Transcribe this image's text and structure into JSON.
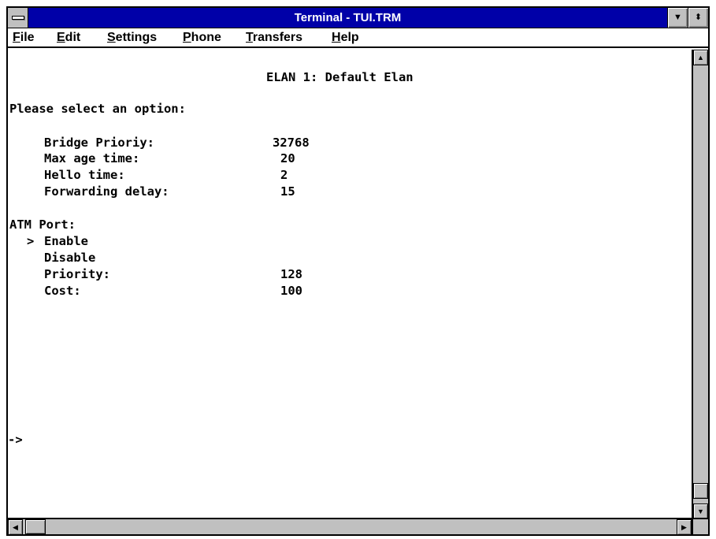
{
  "window": {
    "title": "Terminal - TUI.TRM",
    "minimize_glyph": "▼",
    "maximize_glyph": "⬍"
  },
  "menu": [
    {
      "underline": "F",
      "rest": "ile"
    },
    {
      "underline": "E",
      "rest": "dit"
    },
    {
      "underline": "S",
      "rest": "ettings"
    },
    {
      "underline": "P",
      "rest": "hone"
    },
    {
      "underline": "T",
      "rest": "ransfers"
    },
    {
      "underline": "H",
      "rest": "elp"
    }
  ],
  "terminal": {
    "header": "ELAN 1: Default Elan",
    "prompt_text": "Please select an option:",
    "settings": [
      {
        "label": "Bridge Prioriy:",
        "value": "32768"
      },
      {
        "label": "Max age time:",
        "value": "20"
      },
      {
        "label": "Hello time:",
        "value": "2"
      },
      {
        "label": "Forwarding delay:",
        "value": "15"
      }
    ],
    "atm_port": {
      "heading": "ATM Port:",
      "cursor": ">",
      "options": [
        "Enable",
        "Disable"
      ],
      "fields": [
        {
          "label": "Priority:",
          "value": "128"
        },
        {
          "label": "Cost:",
          "value": "100"
        }
      ]
    },
    "command_prompt": "->"
  },
  "scrollbars": {
    "up_glyph": "▲",
    "down_glyph": "▼",
    "left_glyph": "◀",
    "right_glyph": "▶"
  },
  "colors": {
    "titlebar": "#0000a8",
    "chrome": "#c0c0c0"
  }
}
